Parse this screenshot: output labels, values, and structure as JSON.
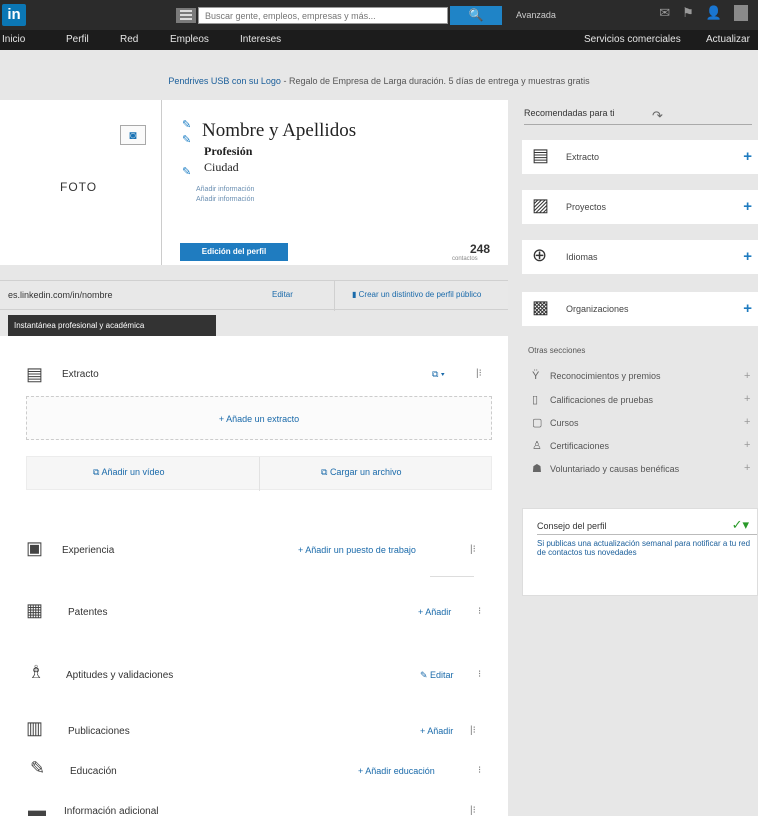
{
  "topbar": {
    "logo": "in",
    "search_placeholder": "Buscar gente, empleos, empresas y más...",
    "search_button": "🔍",
    "advanced": "Avanzada",
    "icons": [
      "message-icon",
      "flag-icon",
      "add-connection-icon",
      "avatar"
    ]
  },
  "nav": {
    "items": [
      "Inicio",
      "Perfil",
      "Red",
      "Empleos",
      "Intereses"
    ],
    "right_items": [
      "Servicios comerciales",
      "Actualizar"
    ]
  },
  "promo": {
    "link": "Pendrives USB con su Logo",
    "text": "- Regalo de Empresa de Larga duración. 5 días de entrega y muestras gratis"
  },
  "profile": {
    "photo_label": "FOTO",
    "name": "Nombre y Apellidos",
    "headline": "Profesión",
    "city": "Ciudad",
    "links": [
      "Añadir información",
      "Añadir información"
    ],
    "edit_button": "Edición del perfil",
    "connections_count": "248",
    "connections_label": "contactos"
  },
  "url_bar": {
    "url": "es.linkedin.com/in/nombre",
    "edit_link": "Editar",
    "public_link": "Crear un distintivo de perfil público"
  },
  "section_tab": "Instantánea profesional y académica",
  "sections": {
    "extracto": {
      "title": "Extracto"
    },
    "add_extract": "+ Añade un extracto",
    "add_video": "Añadir un vídeo",
    "add_file": "Cargar un archivo",
    "experiencia": {
      "title": "Experiencia",
      "action": "+ Añadir un puesto de trabajo"
    },
    "patentes": {
      "title": "Patentes",
      "action": "+ Añadir"
    },
    "aptitudes": {
      "title": "Aptitudes y validaciones",
      "action": "✎ Editar"
    },
    "publicaciones": {
      "title": "Publicaciones",
      "action": "+ Añadir"
    },
    "educacion": {
      "title": "Educación",
      "action": "+ Añadir educación"
    },
    "informacion": {
      "title": "Información adicional"
    }
  },
  "right_panel": {
    "title": "Recomendadas para ti",
    "cards": [
      {
        "label": "Extracto",
        "icon": "document-icon"
      },
      {
        "label": "Proyectos",
        "icon": "clipboard-icon"
      },
      {
        "label": "Idiomas",
        "icon": "globe-icon"
      },
      {
        "label": "Organizaciones",
        "icon": "organization-icon"
      }
    ],
    "others_title": "Otras secciones",
    "others": [
      {
        "label": "Reconocimientos y premios",
        "icon": "award-icon"
      },
      {
        "label": "Calificaciones de pruebas",
        "icon": "test-icon"
      },
      {
        "label": "Cursos",
        "icon": "course-icon"
      },
      {
        "label": "Certificaciones",
        "icon": "certificate-icon"
      },
      {
        "label": "Voluntariado y causas benéficas",
        "icon": "volunteer-icon"
      }
    ],
    "tip_title": "Consejo del perfil",
    "tip_text": "Si publicas una actualización semanal para notificar a tu red de contactos tus novedades"
  }
}
